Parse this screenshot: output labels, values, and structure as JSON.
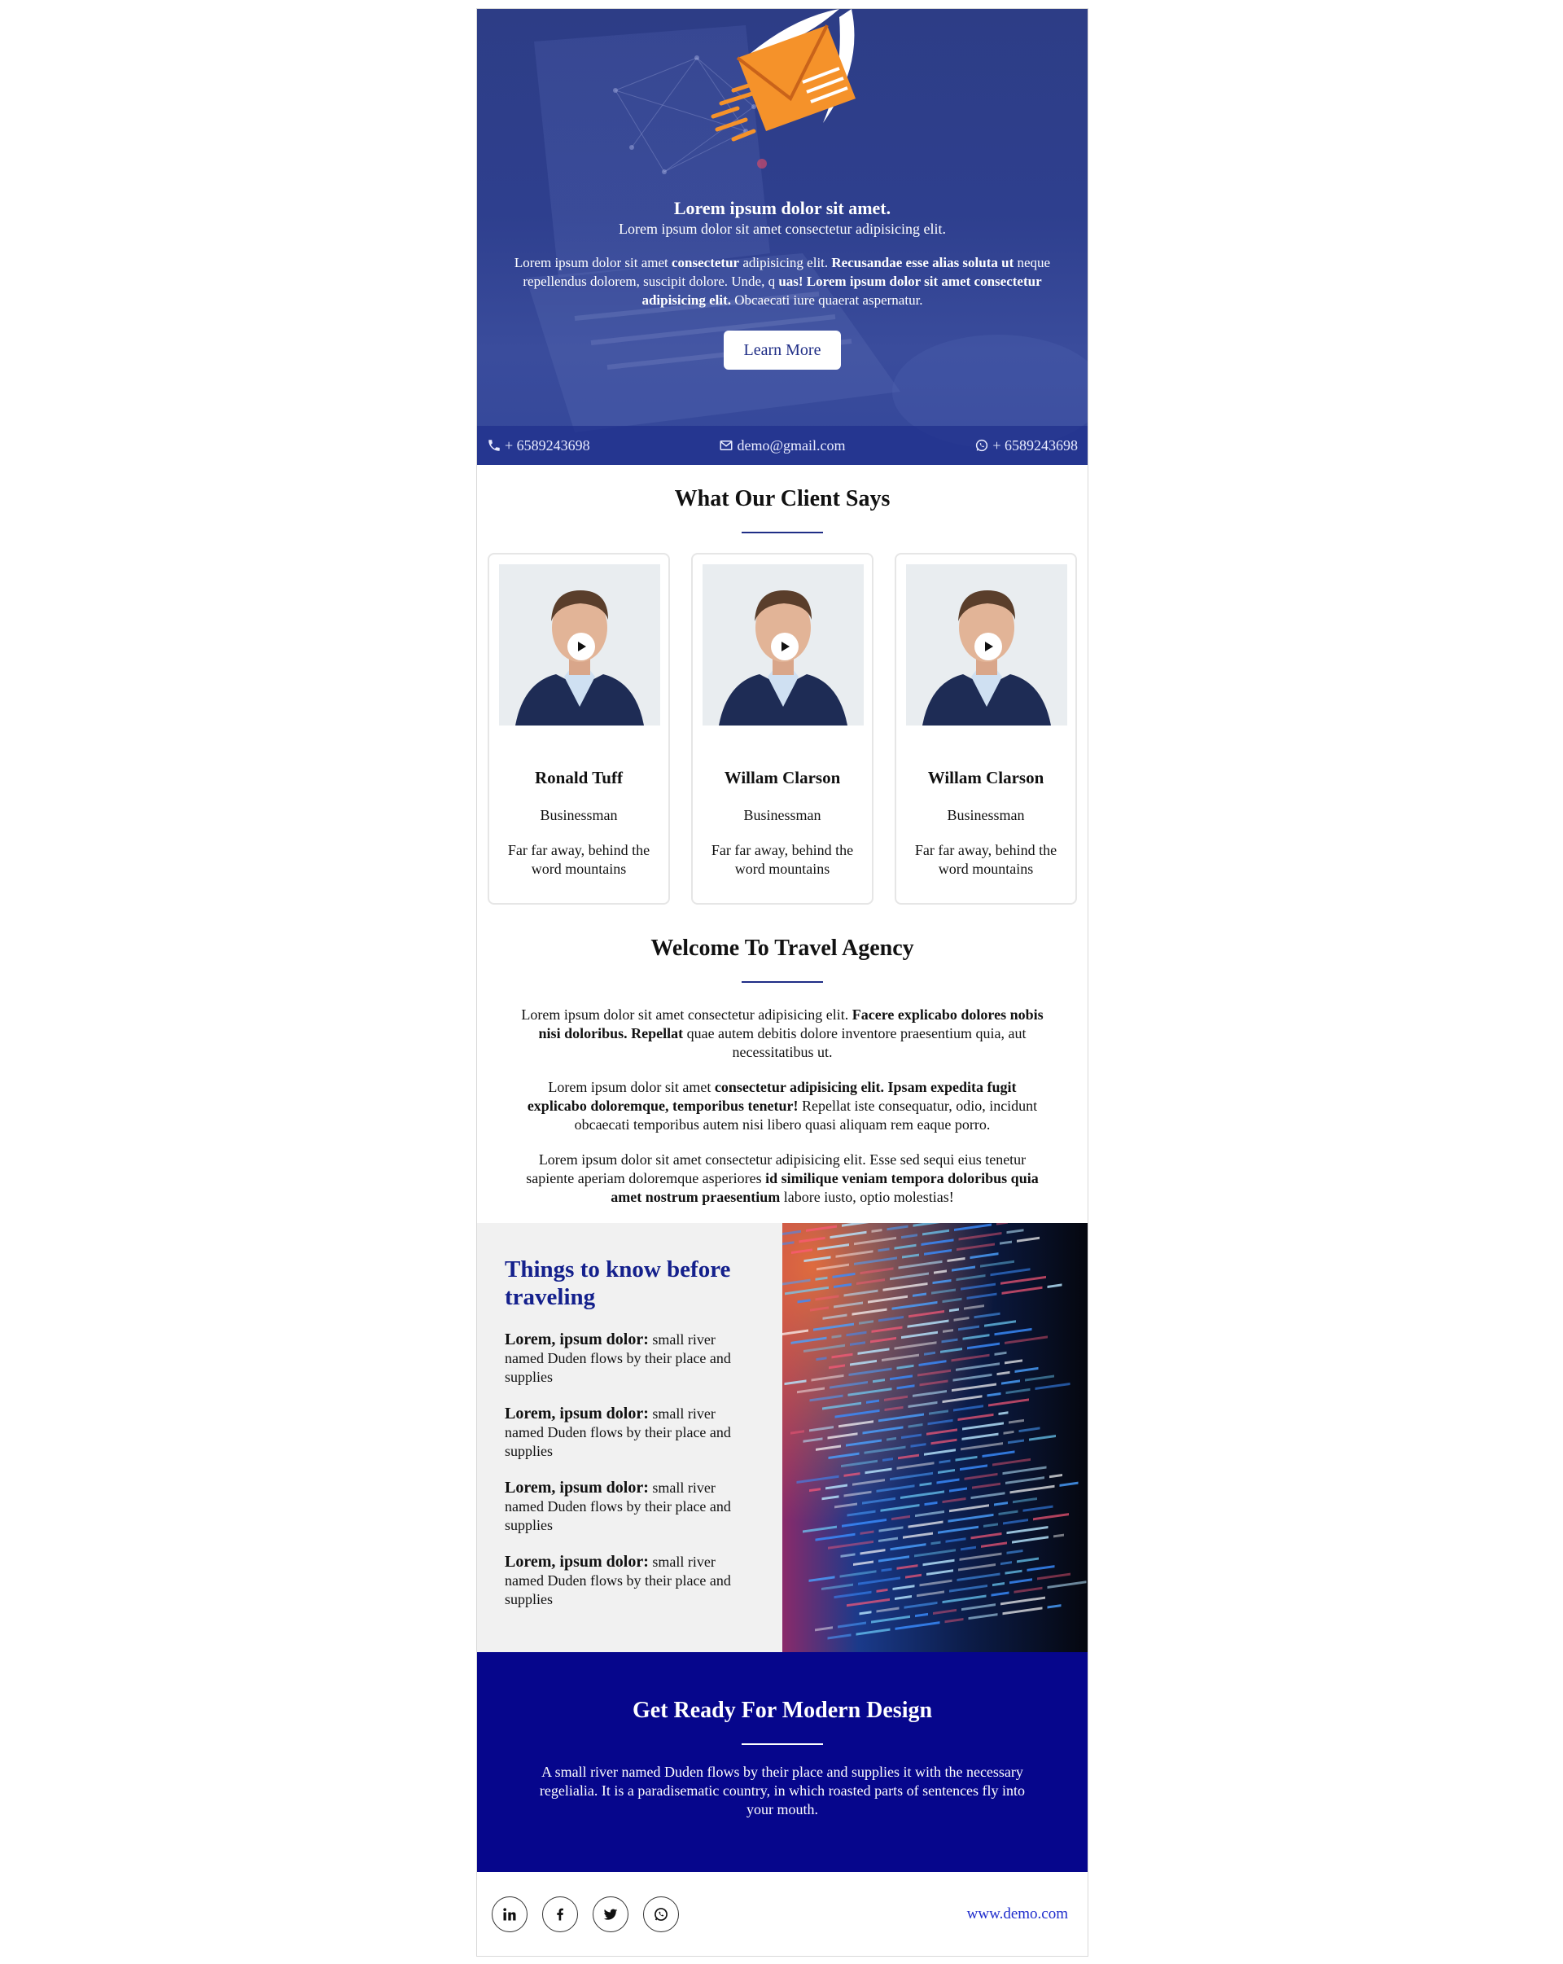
{
  "hero": {
    "title": "Lorem ipsum dolor sit amet.",
    "subtitle": "Lorem ipsum dolor sit amet consectetur adipisicing elit.",
    "body": [
      {
        "t": "Lorem ipsum dolor sit amet ",
        "b": false
      },
      {
        "t": "consectetur",
        "b": true
      },
      {
        "t": " adipisicing elit. ",
        "b": false
      },
      {
        "t": "Recusandae esse alias soluta ut",
        "b": true
      },
      {
        "t": " neque repellendus dolorem, suscipit dolore. Unde, q ",
        "b": false
      },
      {
        "t": "uas! Lorem ipsum dolor sit amet consectetur adipisicing elit.",
        "b": true
      },
      {
        "t": " Obcaecati iure quaerat aspernatur.",
        "b": false
      }
    ],
    "button_label": "Learn More",
    "contact": {
      "phone": "+ 6589243698",
      "email": "demo@gmail.com",
      "whatsapp": "+ 6589243698"
    }
  },
  "clients": {
    "title": "What Our Client Says",
    "cards": [
      {
        "name": "Ronald Tuff",
        "role": "Businessman",
        "text": "Far far away, behind the word mountains"
      },
      {
        "name": "Willam Clarson",
        "role": "Businessman",
        "text": "Far far away, behind the word mountains"
      },
      {
        "name": "Willam Clarson",
        "role": "Businessman",
        "text": "Far far away, behind the word mountains"
      }
    ]
  },
  "welcome": {
    "title": "Welcome To Travel Agency",
    "paragraphs": [
      [
        {
          "t": "Lorem ipsum dolor sit amet consectetur adipisicing elit. ",
          "b": false
        },
        {
          "t": "Facere explicabo dolores nobis nisi doloribus. Repellat",
          "b": true
        },
        {
          "t": " quae autem debitis dolore inventore praesentium quia, aut necessitatibus ut.",
          "b": false
        }
      ],
      [
        {
          "t": "Lorem ipsum dolor sit amet ",
          "b": false
        },
        {
          "t": "consectetur adipisicing elit. Ipsam expedita fugit explicabo doloremque, temporibus tenetur!",
          "b": true
        },
        {
          "t": " Repellat iste consequatur, odio, incidunt obcaecati temporibus autem nisi libero quasi aliquam rem eaque porro.",
          "b": false
        }
      ],
      [
        {
          "t": "Lorem ipsum dolor sit amet consectetur adipisicing elit. Esse sed sequi eius tenetur sapiente aperiam doloremque asperiores ",
          "b": false
        },
        {
          "t": "id similique veniam tempora doloribus quia amet nostrum praesentium",
          "b": true
        },
        {
          "t": " labore iusto, optio molestias!",
          "b": false
        }
      ]
    ]
  },
  "things": {
    "title": "Things to know before traveling",
    "items": [
      {
        "label": "Lorem, ipsum dolor:",
        "text": " small river named Duden flows by their place and supplies"
      },
      {
        "label": "Lorem, ipsum dolor:",
        "text": " small river named Duden flows by their place and supplies"
      },
      {
        "label": "Lorem, ipsum dolor:",
        "text": " small river named Duden flows by their place and supplies"
      },
      {
        "label": "Lorem, ipsum dolor:",
        "text": " small river named Duden flows by their place and supplies"
      }
    ]
  },
  "cta": {
    "title": "Get Ready For Modern Design",
    "body": "A small river named Duden flows by their place and supplies it with the necessary regelialia. It is a paradisematic country, in which roasted parts of sentences fly into your mouth."
  },
  "footer": {
    "socials": [
      "linkedin-icon",
      "facebook-icon",
      "twitter-icon",
      "whatsapp-icon"
    ],
    "site": "www.demo.com"
  },
  "colors": {
    "accent": "#1f2d86",
    "cta_bg": "#06068c",
    "hero_bg": "#2e3f8e"
  }
}
